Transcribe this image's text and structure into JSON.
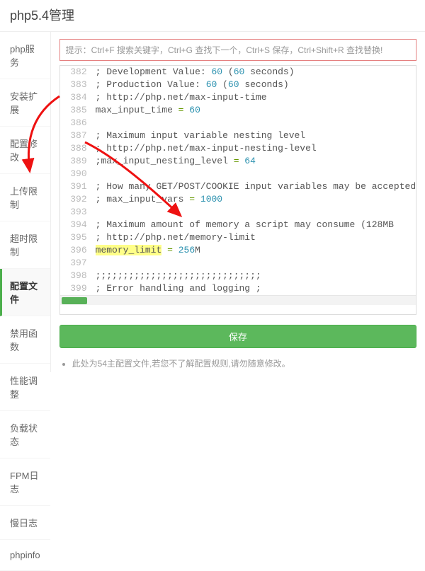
{
  "title": "php5.4管理",
  "sidebar": {
    "items": [
      {
        "label": "php服务"
      },
      {
        "label": "安装扩展"
      },
      {
        "label": "配置修改"
      },
      {
        "label": "上传限制"
      },
      {
        "label": "超时限制"
      },
      {
        "label": "配置文件"
      },
      {
        "label": "禁用函数"
      },
      {
        "label": "性能调整"
      },
      {
        "label": "负载状态"
      },
      {
        "label": "FPM日志"
      },
      {
        "label": "慢日志"
      },
      {
        "label": "phpinfo"
      }
    ]
  },
  "hint": "提示：Ctrl+F 搜索关键字，Ctrl+G 查找下一个，Ctrl+S 保存，Ctrl+Shift+R 查找替换!",
  "code": {
    "lines": [
      {
        "n": "382",
        "raw": "; Development Value: 60 (60 seconds)"
      },
      {
        "n": "383",
        "raw": "; Production Value: 60 (60 seconds)"
      },
      {
        "n": "384",
        "raw": "; http://php.net/max-input-time"
      },
      {
        "n": "385",
        "raw": "max_input_time = 60"
      },
      {
        "n": "386",
        "raw": ""
      },
      {
        "n": "387",
        "raw": "; Maximum input variable nesting level"
      },
      {
        "n": "388",
        "raw": "; http://php.net/max-input-nesting-level"
      },
      {
        "n": "389",
        "raw": ";max_input_nesting_level = 64"
      },
      {
        "n": "390",
        "raw": ""
      },
      {
        "n": "391",
        "raw": "; How many GET/POST/COOKIE input variables may be accepted"
      },
      {
        "n": "392",
        "raw": "; max_input_vars = 1000"
      },
      {
        "n": "393",
        "raw": ""
      },
      {
        "n": "394",
        "raw": "; Maximum amount of memory a script may consume (128MB"
      },
      {
        "n": "395",
        "raw": "; http://php.net/memory-limit"
      },
      {
        "n": "396",
        "raw": "memory_limit = 256M",
        "highlight": "memory_limit",
        "value": "256"
      },
      {
        "n": "397",
        "raw": ""
      },
      {
        "n": "398",
        "raw": ";;;;;;;;;;;;;;;;;;;;;;;;;;;;;;"
      },
      {
        "n": "399",
        "raw": "; Error handling and logging ;"
      }
    ]
  },
  "save_btn": "保存",
  "note": "此处为54主配置文件,若您不了解配置规则,请勿随意修改。"
}
